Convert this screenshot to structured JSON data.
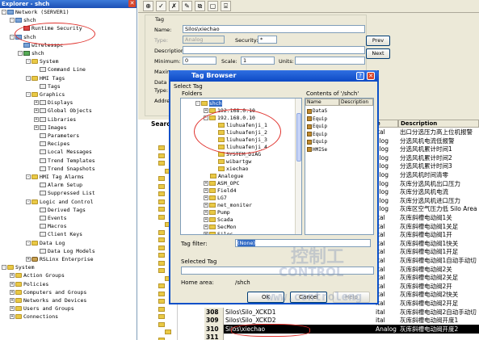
{
  "explorer": {
    "title": "Explorer - shch",
    "close_glyph": "✕",
    "items": [
      {
        "label": "Network (SERVER1)",
        "indent": 0,
        "icon": "network-icon",
        "pm": "-"
      },
      {
        "label": "shch",
        "indent": 1,
        "icon": "computer-icon",
        "pm": "-"
      },
      {
        "label": "Runtime Security",
        "indent": 2,
        "icon": "security-icon",
        "pm": ""
      },
      {
        "label": "shch",
        "indent": 1,
        "icon": "computer-icon",
        "pm": "-"
      },
      {
        "label": "wirelesspc",
        "indent": 2,
        "icon": "computer-icon",
        "pm": ""
      },
      {
        "label": "shch",
        "indent": 2,
        "icon": "application-icon",
        "pm": "-"
      },
      {
        "label": "System",
        "indent": 3,
        "icon": "folder-icon",
        "pm": "-"
      },
      {
        "label": "Command Line",
        "indent": 4,
        "icon": "document-icon",
        "pm": ""
      },
      {
        "label": "HMI Tags",
        "indent": 3,
        "icon": "folder-icon",
        "pm": "-"
      },
      {
        "label": "Tags",
        "indent": 4,
        "icon": "document-icon",
        "pm": ""
      },
      {
        "label": "Graphics",
        "indent": 3,
        "icon": "folder-icon",
        "pm": "-"
      },
      {
        "label": "Displays",
        "indent": 4,
        "icon": "document-icon",
        "pm": "+"
      },
      {
        "label": "Global Objects",
        "indent": 4,
        "icon": "document-icon",
        "pm": "+"
      },
      {
        "label": "Libraries",
        "indent": 4,
        "icon": "document-icon",
        "pm": "+"
      },
      {
        "label": "Images",
        "indent": 4,
        "icon": "document-icon",
        "pm": "+"
      },
      {
        "label": "Parameters",
        "indent": 4,
        "icon": "document-icon",
        "pm": ""
      },
      {
        "label": "Recipes",
        "indent": 4,
        "icon": "document-icon",
        "pm": ""
      },
      {
        "label": "Local Messages",
        "indent": 4,
        "icon": "document-icon",
        "pm": ""
      },
      {
        "label": "Trend Templates",
        "indent": 4,
        "icon": "document-icon",
        "pm": ""
      },
      {
        "label": "Trend Snapshots",
        "indent": 4,
        "icon": "document-icon",
        "pm": ""
      },
      {
        "label": "HMI Tag Alarms",
        "indent": 3,
        "icon": "folder-icon",
        "pm": "-"
      },
      {
        "label": "Alarm Setup",
        "indent": 4,
        "icon": "document-icon",
        "pm": ""
      },
      {
        "label": "Suppressed List",
        "indent": 4,
        "icon": "document-icon",
        "pm": ""
      },
      {
        "label": "Logic and Control",
        "indent": 3,
        "icon": "folder-icon",
        "pm": "-"
      },
      {
        "label": "Derived Tags",
        "indent": 4,
        "icon": "document-icon",
        "pm": ""
      },
      {
        "label": "Events",
        "indent": 4,
        "icon": "document-icon",
        "pm": ""
      },
      {
        "label": "Macros",
        "indent": 4,
        "icon": "document-icon",
        "pm": ""
      },
      {
        "label": "Client Keys",
        "indent": 4,
        "icon": "document-icon",
        "pm": ""
      },
      {
        "label": "Data Log",
        "indent": 3,
        "icon": "folder-icon",
        "pm": "-"
      },
      {
        "label": "Data Log Models",
        "indent": 4,
        "icon": "document-icon",
        "pm": ""
      },
      {
        "label": "RSLinx Enterprise",
        "indent": 3,
        "icon": "rslinx-icon",
        "pm": "+"
      },
      {
        "label": "System",
        "indent": 0,
        "icon": "folder-icon",
        "pm": "-"
      },
      {
        "label": "Action Groups",
        "indent": 1,
        "icon": "folder-icon",
        "pm": "+"
      },
      {
        "label": "Policies",
        "indent": 1,
        "icon": "folder-icon",
        "pm": "+"
      },
      {
        "label": "Computers and Groups",
        "indent": 1,
        "icon": "folder-icon",
        "pm": "+"
      },
      {
        "label": "Networks and Devices",
        "indent": 1,
        "icon": "folder-icon",
        "pm": "+"
      },
      {
        "label": "Users and Groups",
        "indent": 1,
        "icon": "folder-icon",
        "pm": "+"
      },
      {
        "label": "Connections",
        "indent": 1,
        "icon": "folder-icon",
        "pm": "+"
      }
    ]
  },
  "toolbar": {
    "buttons": [
      "⊕",
      "✓",
      "✗",
      "✎",
      "⧉",
      "▢",
      "⌸"
    ]
  },
  "form": {
    "group_label": "Tag",
    "name_label": "Name:",
    "name_value": "Silos\\xiechao",
    "type_label": "Type:",
    "type_value": "Analog",
    "security_label": "Security:",
    "security_value": "*",
    "description_label": "Description:",
    "description_value": "",
    "minimum_label": "Minimum:",
    "minimum_value": "0",
    "scale_label": "Scale:",
    "scale_value": "1",
    "units_label": "Units:",
    "units_value": "",
    "maximum_label": "Maximu",
    "data_source_label": "Data S",
    "ds_type_label": "Type:",
    "address_label": "Addres",
    "prev_label": "Prev",
    "next_label": "Next"
  },
  "search_label": "Searc",
  "grid": {
    "headers": {
      "type": "e",
      "description": "Description"
    },
    "rows": [
      {
        "num": "",
        "name": "",
        "type": "ital",
        "desc": "出口分选压力高上位机报警"
      },
      {
        "num": "",
        "name": "",
        "type": "alog",
        "desc": "分选风机电流低报警"
      },
      {
        "num": "",
        "name": "",
        "type": "alog",
        "desc": "分选风机累计时间1"
      },
      {
        "num": "",
        "name": "",
        "type": "alog",
        "desc": "分选风机累计时间2"
      },
      {
        "num": "",
        "name": "",
        "type": "alog",
        "desc": "分选风机累计时间3"
      },
      {
        "num": "",
        "name": "",
        "type": "alog",
        "desc": "分选风机时间清零"
      },
      {
        "num": "",
        "name": "",
        "type": "alog",
        "desc": "灰库分选风机出口压力"
      },
      {
        "num": "",
        "name": "",
        "type": "alog",
        "desc": "灰库分选风机电流"
      },
      {
        "num": "",
        "name": "",
        "type": "alog",
        "desc": "灰库分选风机进口压力"
      },
      {
        "num": "",
        "name": "",
        "type": "alog",
        "desc": "灰库区空气压力低 Silo Area"
      },
      {
        "num": "",
        "name": "",
        "type": "ital",
        "desc": "灰库斜槽电动阀1关"
      },
      {
        "num": "",
        "name": "",
        "type": "ital",
        "desc": "灰库斜槽电动阀1关足"
      },
      {
        "num": "",
        "name": "",
        "type": "ital",
        "desc": "灰库斜槽电动阀1开"
      },
      {
        "num": "",
        "name": "",
        "type": "ital",
        "desc": "灰库斜槽电动阀1快关"
      },
      {
        "num": "",
        "name": "",
        "type": "ital",
        "desc": "灰库斜槽电动阀1开足"
      },
      {
        "num": "",
        "name": "",
        "type": "ital",
        "desc": "灰库斜槽电动阀1自动手动切"
      },
      {
        "num": "",
        "name": "",
        "type": "ital",
        "desc": "灰库斜槽电动阀2关"
      },
      {
        "num": "",
        "name": "",
        "type": "ital",
        "desc": "灰库斜槽电动阀2关足"
      },
      {
        "num": "",
        "name": "",
        "type": "ital",
        "desc": "灰库斜槽电动阀2开"
      },
      {
        "num": "",
        "name": "",
        "type": "ital",
        "desc": "灰库斜槽电动阀2快关"
      },
      {
        "num": "",
        "name": "",
        "type": "ital",
        "desc": "灰库斜槽电动阀2开足"
      },
      {
        "num": "308",
        "name": "Silos\\Silo_XCKD1",
        "type": "ital",
        "desc": "灰库斜槽电动阀2自动手动切"
      },
      {
        "num": "309",
        "name": "Silos\\Silo_XCKD2",
        "type": "ital",
        "desc": "灰库斜槽电动阀开度1"
      },
      {
        "num": "310",
        "name": "Silos\\xiechao",
        "type": "Analog",
        "desc": "灰库斜槽电动阀开度2",
        "selected": true
      },
      {
        "num": "311",
        "name": "",
        "type": "",
        "desc": ""
      }
    ]
  },
  "dialog": {
    "title": "Tag Browser",
    "help_glyph": "?",
    "close_glyph": "✕",
    "select_tag_label": "Select Tag",
    "folders_label": "Folders",
    "contents_label": "Contents of '/shch'",
    "tree": [
      {
        "label": "shch",
        "indent": 0,
        "pm": "-",
        "selected": true
      },
      {
        "label": "192.168.0.10",
        "indent": 1,
        "pm": "+"
      },
      {
        "label": "192.168.0.10",
        "indent": 1,
        "pm": "-"
      },
      {
        "label": "liuhuafenji_1",
        "indent": 2,
        "pm": ""
      },
      {
        "label": "liuhuafenji_2",
        "indent": 2,
        "pm": ""
      },
      {
        "label": "liuhuafenji_3",
        "indent": 2,
        "pm": ""
      },
      {
        "label": "liuhuafenji_4",
        "indent": 2,
        "pm": ""
      },
      {
        "label": "SYSTEM_DIAG",
        "indent": 2,
        "pm": ""
      },
      {
        "label": "wibartgw",
        "indent": 2,
        "pm": ""
      },
      {
        "label": "xiechao",
        "indent": 2,
        "pm": ""
      },
      {
        "label": "Analogue",
        "indent": 1,
        "pm": ""
      },
      {
        "label": "ASM_OPC",
        "indent": 1,
        "pm": "+"
      },
      {
        "label": "Field4",
        "indent": 1,
        "pm": "+"
      },
      {
        "label": "LG7",
        "indent": 1,
        "pm": "+"
      },
      {
        "label": "net_moniter",
        "indent": 1,
        "pm": "+"
      },
      {
        "label": "Pump",
        "indent": 1,
        "pm": "+"
      },
      {
        "label": "Scada",
        "indent": 1,
        "pm": "+"
      },
      {
        "label": "SecMon",
        "indent": 1,
        "pm": "+"
      },
      {
        "label": "Silos",
        "indent": 1,
        "pm": "+"
      }
    ],
    "contents_headers": {
      "name": "Name",
      "description": "Description"
    },
    "contents": [
      "DataS",
      "Equip",
      "Equip",
      "Equip",
      "Equip",
      "HMISe"
    ],
    "tag_filter_label": "Tag filter:",
    "tag_filter_value": "(None)",
    "selected_tag_label": "Selected Tag",
    "selected_tag_value": "",
    "home_area_label": "Home area:",
    "home_area_value": "/shch",
    "ok_label": "OK",
    "cancel_label": "Cancel",
    "help_label": "Help"
  },
  "watermark": {
    "cn": "控制工",
    "en": "CONTROL",
    "url": "www.controleng"
  },
  "colors": {
    "annotation": "#e0312c",
    "selection": "#316ac5",
    "titlebar": "#0d49c4"
  }
}
